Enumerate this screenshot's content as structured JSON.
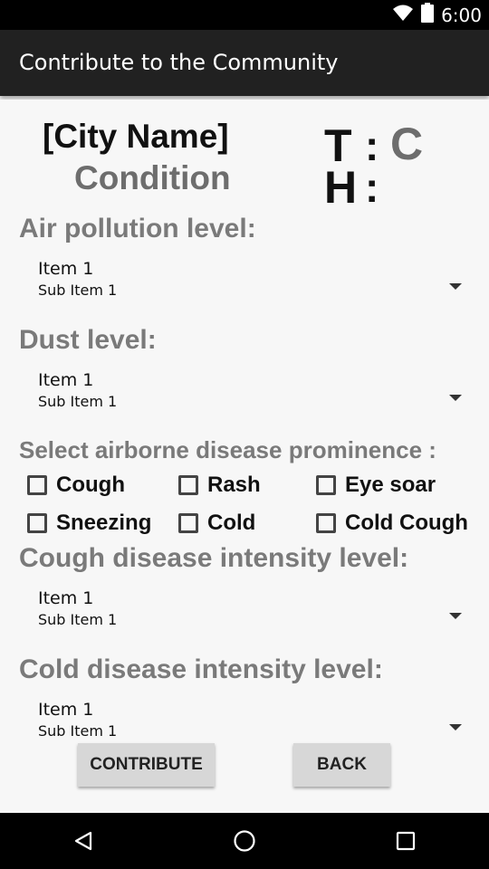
{
  "status_bar": {
    "time": "6:00",
    "icons": [
      "wifi-icon",
      "battery-icon"
    ]
  },
  "app_bar": {
    "title": "Contribute to the Community"
  },
  "header": {
    "city_name": "[City Name]",
    "condition": "Condition",
    "temp_label": "T",
    "temp_colon": ":",
    "temp_unit": "C",
    "humidity_label": "H",
    "humidity_colon": ":"
  },
  "air_pollution": {
    "label": "Air pollution level:",
    "selected_item": "Item 1",
    "selected_sub_item": "Sub Item 1"
  },
  "dust": {
    "label": "Dust level:",
    "selected_item": "Item 1",
    "selected_sub_item": "Sub Item 1"
  },
  "disease_prominence": {
    "label": "Select airborne disease prominence :",
    "options": [
      {
        "label": "Cough",
        "checked": false
      },
      {
        "label": "Rash",
        "checked": false
      },
      {
        "label": "Eye soar",
        "checked": false
      },
      {
        "label": "Sneezing",
        "checked": false
      },
      {
        "label": "Cold",
        "checked": false
      },
      {
        "label": "Cold Cough",
        "checked": false
      }
    ]
  },
  "cough_intensity": {
    "label": "Cough disease intensity level:",
    "selected_item": "Item 1",
    "selected_sub_item": "Sub Item 1"
  },
  "cold_intensity": {
    "label": "Cold disease intensity level:",
    "selected_item": "Item 1",
    "selected_sub_item": "Sub Item 1"
  },
  "actions": {
    "contribute_label": "CONTRIBUTE",
    "back_label": "BACK"
  },
  "nav_bar": {
    "icons": [
      "back-triangle-icon",
      "home-circle-icon",
      "recents-square-icon"
    ]
  },
  "colors": {
    "app_bar": "#212121",
    "background": "#f7f7f7",
    "label_gray": "#7a7a7a",
    "button": "#d7d7d7"
  }
}
